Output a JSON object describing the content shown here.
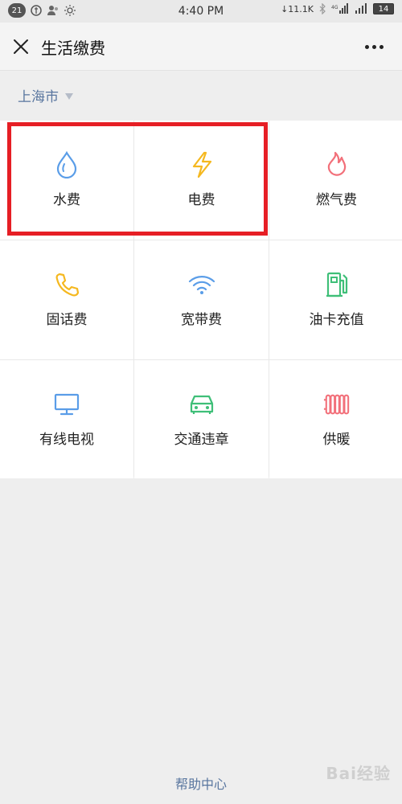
{
  "status_bar": {
    "notification_count": "21",
    "time": "4:40 PM",
    "network_speed": "11.1K",
    "battery": "14"
  },
  "nav": {
    "title": "生活缴费"
  },
  "city": {
    "name": "上海市"
  },
  "services": [
    {
      "label": "水费",
      "icon": "water-drop-icon",
      "color": "#5a9de8"
    },
    {
      "label": "电费",
      "icon": "lightning-icon",
      "color": "#f5b81f"
    },
    {
      "label": "燃气费",
      "icon": "flame-icon",
      "color": "#f2707a"
    },
    {
      "label": "固话费",
      "icon": "phone-icon",
      "color": "#f5b81f"
    },
    {
      "label": "宽带费",
      "icon": "wifi-icon",
      "color": "#5a9de8"
    },
    {
      "label": "油卡充值",
      "icon": "fuel-pump-icon",
      "color": "#3fbf78"
    },
    {
      "label": "有线电视",
      "icon": "tv-monitor-icon",
      "color": "#5a9de8"
    },
    {
      "label": "交通违章",
      "icon": "car-icon",
      "color": "#3fbf78"
    },
    {
      "label": "供暖",
      "icon": "radiator-icon",
      "color": "#f2707a"
    }
  ],
  "footer": {
    "help_label": "帮助中心"
  },
  "watermark": "Bai经验"
}
